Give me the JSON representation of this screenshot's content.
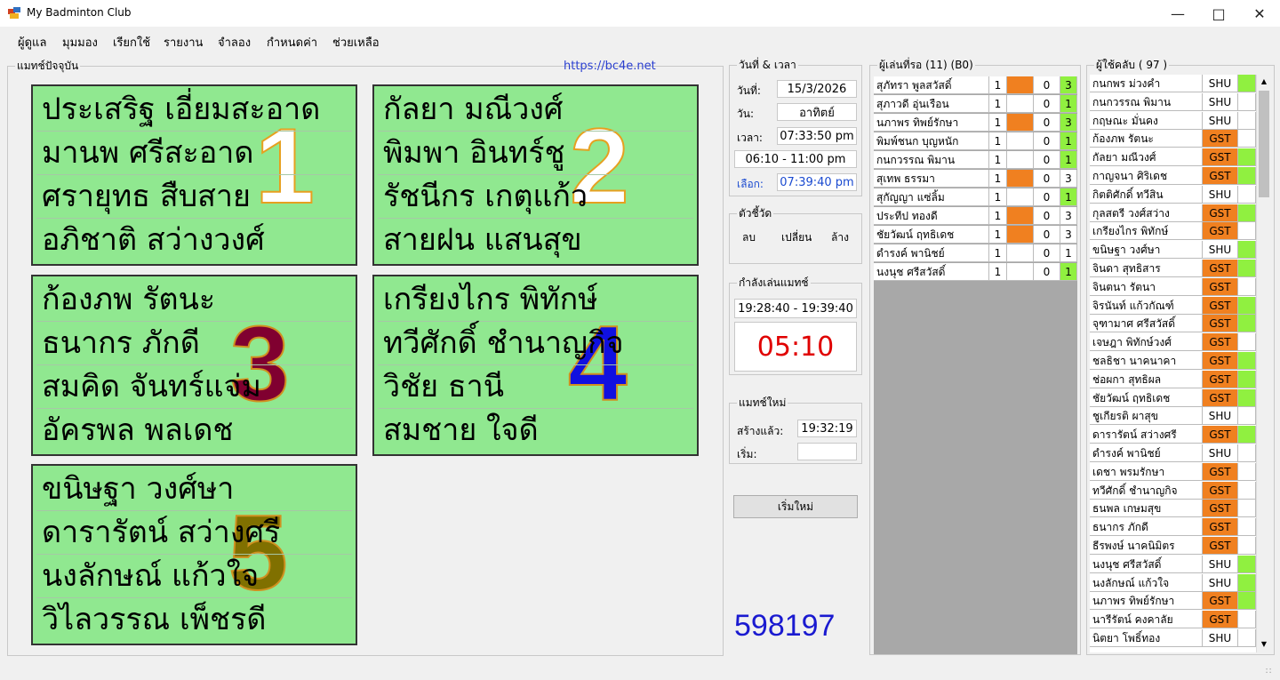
{
  "window": {
    "title": "My Badminton Club"
  },
  "menu": [
    "ผู้ดูแล",
    "มุมมอง",
    "เรียกใช้",
    "รายงาน",
    "จำลอง",
    "กำหนดค่า",
    "ช่วยเหลือ"
  ],
  "current_matches": {
    "title": "แมทช์ปัจจุบัน",
    "link": "https://bc4e.net",
    "courts": [
      {
        "number": "1",
        "players": [
          "ประเสริฐ เอี่ยมสะอาด",
          "มานพ ศรีสะอาด",
          "ศรายุทธ สืบสาย",
          "อภิชาติ สว่างวงศ์"
        ]
      },
      {
        "number": "2",
        "players": [
          "กัลยา มณีวงศ์",
          "พิมพา อินทร์ชู",
          "รัชนีกร เกตุแก้ว",
          "สายฝน แสนสุข"
        ]
      },
      {
        "number": "3",
        "players": [
          "ก้องภพ รัตนะ",
          "ธนากร ภักดี",
          "สมคิด จันทร์แจ่ม",
          "อัครพล พลเดช"
        ]
      },
      {
        "number": "4",
        "players": [
          "เกรียงไกร พิทักษ์",
          "ทวีศักดิ์ ชำนาญกิจ",
          "วิชัย ธานี",
          "สมชาย ใจดี"
        ]
      },
      {
        "number": "5",
        "players": [
          "ขนิษฐา วงศ์ษา",
          "ดารารัตน์ สว่างศรี",
          "นงลักษณ์ แก้วใจ",
          "วิไลวรรณ เพ็ชรดี"
        ]
      }
    ]
  },
  "datetime": {
    "title": "วันที่ & เวลา",
    "date_label": "วันที่:",
    "date": "15/3/2026",
    "day_label": "วัน:",
    "day": "อาทิตย์",
    "time_label": "เวลา:",
    "time": "07:33:50 pm",
    "session": "06:10 - 11:00 pm",
    "select_label": "เลือก:",
    "select_time": "07:39:40 pm"
  },
  "indicator": {
    "title": "ตัวชี้วัด",
    "delete": "ลบ",
    "change": "เปลี่ยน",
    "clear": "ล้าง"
  },
  "playing": {
    "title": "กำลังเล่นแมทช์",
    "range": "19:28:40 - 19:39:40",
    "countdown": "05:10"
  },
  "new_match": {
    "title": "แมทช์ใหม่",
    "created_label": "สร้างแล้ว:",
    "created": "19:32:19",
    "start_label": "เริ่ม:",
    "start": "",
    "restart_button": "เริ่มใหม่"
  },
  "code": "598197",
  "waiting": {
    "title": "ผู้เล่นที่รอ (11) (B0)",
    "rows": [
      {
        "name": "สุภัทรา พูลสวัสดิ์",
        "a": "1",
        "b_orange": true,
        "c": "0",
        "d": "3",
        "d_green": true
      },
      {
        "name": "สุภาวดี อุ่นเรือน",
        "a": "1",
        "b_orange": false,
        "c": "0",
        "d": "1",
        "d_green": true
      },
      {
        "name": "นภาพร ทิพย์รักษา",
        "a": "1",
        "b_orange": true,
        "c": "0",
        "d": "3",
        "d_green": true
      },
      {
        "name": "พิมพ์ชนก บุญหนัก",
        "a": "1",
        "b_orange": false,
        "c": "0",
        "d": "1",
        "d_green": true
      },
      {
        "name": "กนกวรรณ พิมาน",
        "a": "1",
        "b_orange": false,
        "c": "0",
        "d": "1",
        "d_green": true
      },
      {
        "name": "สุเทพ ธรรมา",
        "a": "1",
        "b_orange": true,
        "c": "0",
        "d": "3",
        "d_green": false
      },
      {
        "name": "สุกัญญา แซ่ลิ้ม",
        "a": "1",
        "b_orange": false,
        "c": "0",
        "d": "1",
        "d_green": true
      },
      {
        "name": "ประทีป ทองดี",
        "a": "1",
        "b_orange": true,
        "c": "0",
        "d": "3",
        "d_green": false
      },
      {
        "name": "ชัยวัฒน์ ฤทธิเดช",
        "a": "1",
        "b_orange": true,
        "c": "0",
        "d": "3",
        "d_green": false
      },
      {
        "name": "ดำรงค์ พานิชย์",
        "a": "1",
        "b_orange": false,
        "c": "0",
        "d": "1",
        "d_green": false
      },
      {
        "name": "นงนุช ศรีสวัสดิ์",
        "a": "1",
        "b_orange": false,
        "c": "0",
        "d": "1",
        "d_green": true
      }
    ]
  },
  "members": {
    "title": "ผู้ใช้คลับ ( 97 )",
    "rows": [
      {
        "name": "กนกพร ม่วงคำ",
        "type": "SHU",
        "green": true
      },
      {
        "name": "กนกวรรณ พิมาน",
        "type": "SHU",
        "green": false
      },
      {
        "name": "กฤษณะ มั่นคง",
        "type": "SHU",
        "green": false
      },
      {
        "name": "ก้องภพ รัตนะ",
        "type": "GST",
        "green": false
      },
      {
        "name": "กัลยา มณีวงศ์",
        "type": "GST",
        "green": true
      },
      {
        "name": "กาญจนา ศิริเดช",
        "type": "GST",
        "green": true
      },
      {
        "name": "กิตติศักดิ์ ทวีสิน",
        "type": "SHU",
        "green": false
      },
      {
        "name": "กุลสตรี วงศ์สว่าง",
        "type": "GST",
        "green": true
      },
      {
        "name": "เกรียงไกร พิทักษ์",
        "type": "GST",
        "green": false
      },
      {
        "name": "ขนิษฐา วงศ์ษา",
        "type": "SHU",
        "green": true
      },
      {
        "name": "จินดา สุทธิสาร",
        "type": "GST",
        "green": true
      },
      {
        "name": "จินตนา รัตนา",
        "type": "GST",
        "green": false
      },
      {
        "name": "จิรนันท์ แก้วกัณฑ์",
        "type": "GST",
        "green": true
      },
      {
        "name": "จุฑามาศ ศรีสวัสดิ์",
        "type": "GST",
        "green": true
      },
      {
        "name": "เจษฎา พิทักษ์วงศ์",
        "type": "GST",
        "green": false
      },
      {
        "name": "ชลธิชา นาคนาคา",
        "type": "GST",
        "green": true
      },
      {
        "name": "ช่อผกา สุทธิผล",
        "type": "GST",
        "green": true
      },
      {
        "name": "ชัยวัฒน์ ฤทธิเดช",
        "type": "GST",
        "green": true
      },
      {
        "name": "ชูเกียรติ ผาสุข",
        "type": "SHU",
        "green": false
      },
      {
        "name": "ดารารัตน์ สว่างศรี",
        "type": "GST",
        "green": true
      },
      {
        "name": "ดำรงค์ พานิชย์",
        "type": "SHU",
        "green": false
      },
      {
        "name": "เดชา พรมรักษา",
        "type": "GST",
        "green": false
      },
      {
        "name": "ทวีศักดิ์ ชำนาญกิจ",
        "type": "GST",
        "green": false
      },
      {
        "name": "ธนพล เกษมสุข",
        "type": "GST",
        "green": false
      },
      {
        "name": "ธนากร ภักดี",
        "type": "GST",
        "green": false
      },
      {
        "name": "ธีรพงษ์ นาคนิมิตร",
        "type": "GST",
        "green": false
      },
      {
        "name": "นงนุช ศรีสวัสดิ์",
        "type": "SHU",
        "green": true
      },
      {
        "name": "นงลักษณ์ แก้วใจ",
        "type": "SHU",
        "green": true
      },
      {
        "name": "นภาพร ทิพย์รักษา",
        "type": "GST",
        "green": true
      },
      {
        "name": "นารีรัตน์ คงคาลัย",
        "type": "GST",
        "green": false
      },
      {
        "name": "นิตยา โพธิ์ทอง",
        "type": "SHU",
        "green": false
      }
    ]
  }
}
